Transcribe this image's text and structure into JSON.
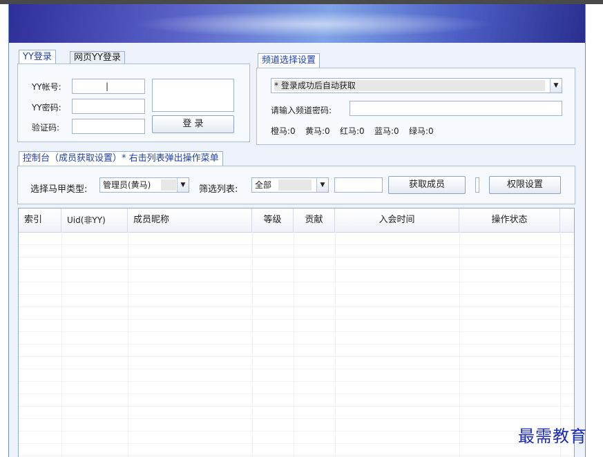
{
  "login": {
    "tab_active": "YY登录",
    "tab_inactive": "网页YY登录",
    "account_label": "YY帐号:",
    "password_label": "YY密码:",
    "captcha_label": "验证码:",
    "account_value": "|",
    "login_button": "登 录"
  },
  "channel": {
    "tab": "频道选择设置",
    "channel_select": "* 登录成功后自动获取",
    "password_label": "请输入频道密码:",
    "counts": [
      {
        "label": "橙马:",
        "value": "0"
      },
      {
        "label": "黄马:",
        "value": "0"
      },
      {
        "label": "红马:",
        "value": "0"
      },
      {
        "label": "蓝马:",
        "value": "0"
      },
      {
        "label": "绿马:",
        "value": "0"
      }
    ]
  },
  "console": {
    "tab": "控制台（成员获取设置）* 右击列表弹出操作菜单",
    "vest_label": "选择马甲类型:",
    "vest_value": "管理员(黄马)",
    "filter_label": "筛选列表:",
    "filter_value": "全部",
    "fetch_button": "获取成员",
    "permission_button": "权限设置"
  },
  "table": {
    "columns": [
      "索引",
      "Uid(非YY)",
      "成员昵称",
      "等级",
      "贡献",
      "入会时间",
      "操作状态"
    ]
  },
  "watermark": "最需教育",
  "colors": {
    "accent": "#1f3fa8",
    "border": "#a9bcd8",
    "banner_start": "#2f2f9a",
    "banner_end": "#2a2f8e"
  }
}
